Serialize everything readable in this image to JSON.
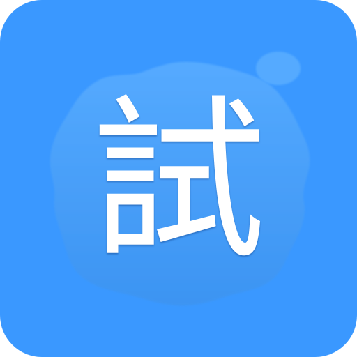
{
  "app_icon": {
    "glyph": "試",
    "colors": {
      "background": "#3a98ff",
      "blob": "#4aa3ff",
      "glyph": "#ffffff"
    }
  }
}
